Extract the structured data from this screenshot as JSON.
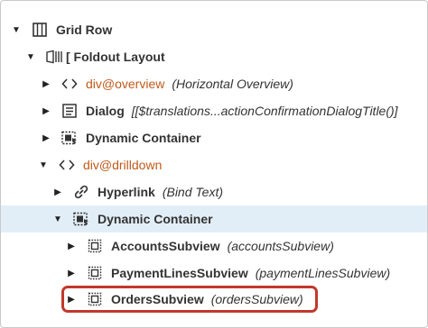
{
  "tree": {
    "nodes": [
      {
        "label": "Grid Row",
        "detail": "",
        "twisty": "▼",
        "icon": "grid-row-icon"
      },
      {
        "label": "[ Foldout Layout",
        "detail": "",
        "twisty": "▼",
        "icon": "foldout-layout-icon"
      },
      {
        "label": "div@overview",
        "detail": "(Horizontal Overview)",
        "twisty": "▶",
        "icon": "code-tag-icon"
      },
      {
        "label": "Dialog",
        "detail": "[[$translations...actionConfirmationDialogTitle()]",
        "twisty": "▶",
        "icon": "dialog-icon"
      },
      {
        "label": "Dynamic Container",
        "detail": "",
        "twisty": "▶",
        "icon": "dynamic-container-icon"
      },
      {
        "label": "div@drilldown",
        "detail": "",
        "twisty": "▼",
        "icon": "code-tag-icon"
      },
      {
        "label": "Hyperlink",
        "detail": "(Bind Text)",
        "twisty": "▶",
        "icon": "link-icon"
      },
      {
        "label": "Dynamic Container",
        "detail": "",
        "twisty": "▼",
        "icon": "dynamic-container-icon"
      },
      {
        "label": "AccountsSubview",
        "detail": "(accountsSubview)",
        "twisty": "▶",
        "icon": "subview-icon"
      },
      {
        "label": "PaymentLinesSubview",
        "detail": "(paymentLinesSubview)",
        "twisty": "▶",
        "icon": "subview-icon"
      },
      {
        "label": "OrdersSubview",
        "detail": "(ordersSubview)",
        "twisty": "▶",
        "icon": "subview-icon"
      }
    ]
  },
  "colors": {
    "selected_row": "#e2eef7",
    "highlight_border": "#c0392b",
    "html_tag_text": "#c05a1b"
  }
}
